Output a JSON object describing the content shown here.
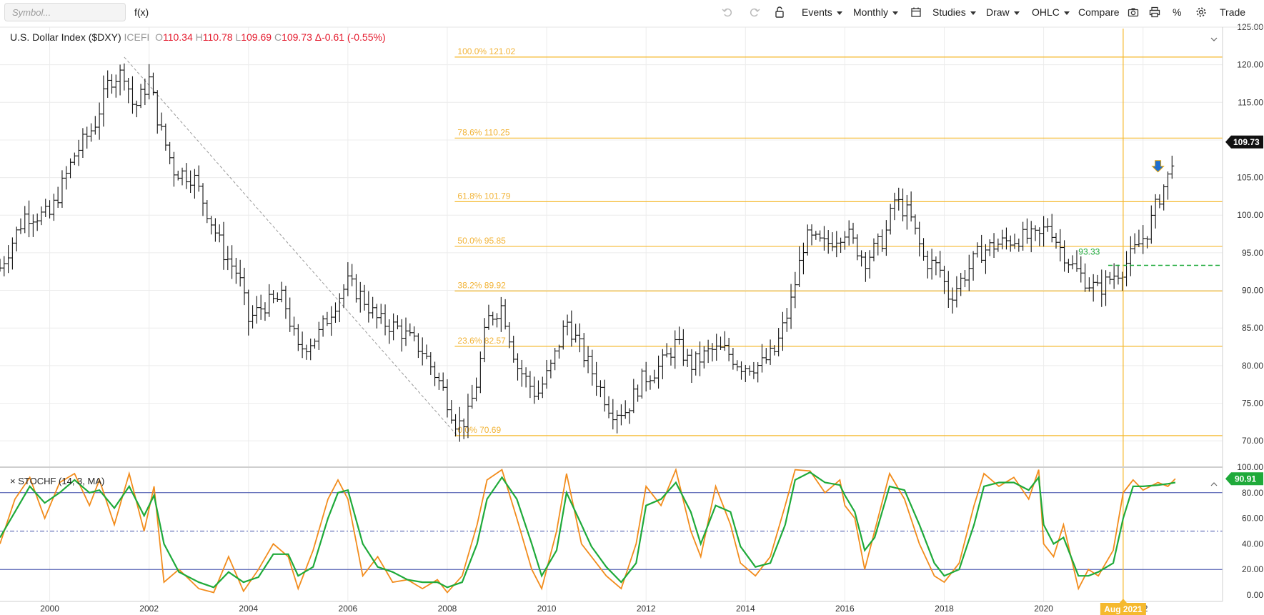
{
  "toolbar": {
    "symbol_placeholder": "Symbol...",
    "fx_label": "f(x)",
    "events_label": "Events",
    "period_label": "Monthly",
    "studies_label": "Studies",
    "draw_label": "Draw",
    "charttype_label": "OHLC",
    "compare_label": "Compare",
    "percent_label": "%",
    "trade_label": "Trade"
  },
  "header": {
    "name": "U.S. Dollar Index ($DXY)",
    "exchange": "ICEFI",
    "o_label": "O",
    "open": "110.34",
    "h_label": "H",
    "high": "110.78",
    "l_label": "L",
    "low": "109.69",
    "c_label": "C",
    "close": "109.73",
    "change": "Δ-0.61 (-0.55%)"
  },
  "stoch": {
    "label": "STOCHF (14, 3, MA)",
    "close_symbol": "×"
  },
  "colors": {
    "fib": "#f5b92e",
    "fib_text": "#f2b438",
    "price_bar": "#111111",
    "stoch_k": "#f28c1c",
    "stoch_d": "#1faa3a",
    "level_line": "#3b4aa8",
    "support": "#1faa3a",
    "vertical_marker": "#f5b92e",
    "arrow": "#1f6fd1"
  },
  "chart_data": [
    {
      "type": "ohlc",
      "title": "U.S. Dollar Index ($DXY)",
      "period": "monthly",
      "ylim": [
        66.5,
        125
      ],
      "y_ticks": [
        "125.00",
        "120.00",
        "115.00",
        "110.00",
        "105.00",
        "100.00",
        "95.00",
        "90.00",
        "85.00",
        "80.00",
        "75.00",
        "70.00"
      ],
      "x_ticks": [
        "2000",
        "2002",
        "2004",
        "2006",
        "2008",
        "2010",
        "2012",
        "2014",
        "2016",
        "2018",
        "2020",
        "22"
      ],
      "x_highlight": "Aug 2021",
      "last_price": "109.73",
      "support_label": "93.33",
      "support_level": 93.33,
      "fib_levels": [
        {
          "label": "100.0% 121.02",
          "value": 121.02
        },
        {
          "label": "78.6% 110.25",
          "value": 110.25
        },
        {
          "label": "61.8% 101.79",
          "value": 101.79
        },
        {
          "label": "50.0% 95.85",
          "value": 95.85
        },
        {
          "label": "38.2% 89.92",
          "value": 89.92
        },
        {
          "label": "23.6% 82.57",
          "value": 82.57
        },
        {
          "label": "0.0% 70.69",
          "value": 70.69
        }
      ],
      "trendline": [
        {
          "x": 2001.5,
          "y": 121.02
        },
        {
          "x": 2008.2,
          "y": 70.69
        }
      ],
      "price_path": [
        [
          1999.0,
          93
        ],
        [
          1999.5,
          100
        ],
        [
          2000.0,
          100
        ],
        [
          2000.5,
          108
        ],
        [
          2000.9,
          112
        ],
        [
          2001.2,
          118
        ],
        [
          2001.5,
          119
        ],
        [
          2001.7,
          114
        ],
        [
          2002.0,
          118
        ],
        [
          2002.2,
          112
        ],
        [
          2002.5,
          106
        ],
        [
          2002.9,
          105
        ],
        [
          2003.2,
          100
        ],
        [
          2003.5,
          95
        ],
        [
          2003.8,
          92
        ],
        [
          2004.0,
          86
        ],
        [
          2004.3,
          88
        ],
        [
          2004.7,
          89
        ],
        [
          2005.0,
          82
        ],
        [
          2005.4,
          84
        ],
        [
          2005.8,
          89
        ],
        [
          2006.0,
          91
        ],
        [
          2006.3,
          89
        ],
        [
          2006.6,
          86
        ],
        [
          2007.0,
          85
        ],
        [
          2007.5,
          82
        ],
        [
          2007.9,
          77
        ],
        [
          2008.2,
          72
        ],
        [
          2008.4,
          73
        ],
        [
          2008.6,
          78
        ],
        [
          2008.8,
          86
        ],
        [
          2009.1,
          88
        ],
        [
          2009.4,
          80
        ],
        [
          2009.8,
          76
        ],
        [
          2010.1,
          80
        ],
        [
          2010.4,
          86
        ],
        [
          2010.7,
          82
        ],
        [
          2011.0,
          78
        ],
        [
          2011.3,
          74
        ],
        [
          2011.6,
          74
        ],
        [
          2011.9,
          78
        ],
        [
          2012.3,
          80
        ],
        [
          2012.6,
          83
        ],
        [
          2012.9,
          80
        ],
        [
          2013.3,
          82
        ],
        [
          2013.6,
          82
        ],
        [
          2013.9,
          80
        ],
        [
          2014.3,
          80
        ],
        [
          2014.6,
          82
        ],
        [
          2014.9,
          88
        ],
        [
          2015.2,
          97
        ],
        [
          2015.6,
          96
        ],
        [
          2016.0,
          98
        ],
        [
          2016.4,
          94
        ],
        [
          2016.8,
          97
        ],
        [
          2017.0,
          102
        ],
        [
          2017.3,
          100
        ],
        [
          2017.6,
          94
        ],
        [
          2017.9,
          93
        ],
        [
          2018.1,
          89
        ],
        [
          2018.4,
          92
        ],
        [
          2018.7,
          95
        ],
        [
          2019.0,
          96
        ],
        [
          2019.5,
          97
        ],
        [
          2019.9,
          97
        ],
        [
          2020.1,
          99
        ],
        [
          2020.3,
          96
        ],
        [
          2020.6,
          93
        ],
        [
          2020.9,
          91
        ],
        [
          2021.1,
          90
        ],
        [
          2021.4,
          92
        ],
        [
          2021.6,
          93
        ],
        [
          2021.9,
          96
        ],
        [
          2022.1,
          98
        ],
        [
          2022.3,
          102
        ],
        [
          2022.5,
          105
        ],
        [
          2022.65,
          109.73
        ]
      ]
    },
    {
      "type": "line",
      "title": "STOCHF (14, 3, MA)",
      "ylim": [
        -5,
        100
      ],
      "y_ticks": [
        "100.00",
        "80.00",
        "60.00",
        "40.00",
        "20.00",
        "0.00"
      ],
      "levels": [
        80,
        50,
        20
      ],
      "last_value": "90.91",
      "series": [
        {
          "name": "%K",
          "points": [
            [
              1999.0,
              40
            ],
            [
              1999.3,
              75
            ],
            [
              1999.6,
              92
            ],
            [
              1999.9,
              60
            ],
            [
              2000.2,
              88
            ],
            [
              2000.5,
              95
            ],
            [
              2000.8,
              70
            ],
            [
              2001.0,
              90
            ],
            [
              2001.3,
              55
            ],
            [
              2001.6,
              95
            ],
            [
              2001.9,
              50
            ],
            [
              2002.1,
              85
            ],
            [
              2002.3,
              10
            ],
            [
              2002.6,
              20
            ],
            [
              2003.0,
              5
            ],
            [
              2003.3,
              2
            ],
            [
              2003.6,
              30
            ],
            [
              2003.9,
              3
            ],
            [
              2004.2,
              20
            ],
            [
              2004.5,
              40
            ],
            [
              2004.8,
              30
            ],
            [
              2005.0,
              5
            ],
            [
              2005.3,
              35
            ],
            [
              2005.6,
              75
            ],
            [
              2005.8,
              90
            ],
            [
              2006.0,
              75
            ],
            [
              2006.3,
              15
            ],
            [
              2006.6,
              30
            ],
            [
              2006.9,
              10
            ],
            [
              2007.2,
              12
            ],
            [
              2007.5,
              5
            ],
            [
              2007.8,
              12
            ],
            [
              2008.0,
              2
            ],
            [
              2008.3,
              15
            ],
            [
              2008.6,
              55
            ],
            [
              2008.8,
              90
            ],
            [
              2009.1,
              98
            ],
            [
              2009.4,
              60
            ],
            [
              2009.7,
              20
            ],
            [
              2009.9,
              5
            ],
            [
              2010.2,
              50
            ],
            [
              2010.4,
              95
            ],
            [
              2010.7,
              40
            ],
            [
              2010.9,
              30
            ],
            [
              2011.2,
              15
            ],
            [
              2011.5,
              5
            ],
            [
              2011.8,
              40
            ],
            [
              2012.0,
              85
            ],
            [
              2012.3,
              70
            ],
            [
              2012.6,
              98
            ],
            [
              2012.9,
              50
            ],
            [
              2013.1,
              30
            ],
            [
              2013.4,
              85
            ],
            [
              2013.7,
              55
            ],
            [
              2013.9,
              25
            ],
            [
              2014.2,
              15
            ],
            [
              2014.5,
              30
            ],
            [
              2014.8,
              70
            ],
            [
              2015.0,
              98
            ],
            [
              2015.3,
              97
            ],
            [
              2015.6,
              80
            ],
            [
              2015.9,
              90
            ],
            [
              2016.0,
              70
            ],
            [
              2016.2,
              60
            ],
            [
              2016.4,
              20
            ],
            [
              2016.6,
              50
            ],
            [
              2016.9,
              95
            ],
            [
              2017.2,
              75
            ],
            [
              2017.5,
              40
            ],
            [
              2017.8,
              15
            ],
            [
              2018.0,
              10
            ],
            [
              2018.3,
              25
            ],
            [
              2018.6,
              70
            ],
            [
              2018.8,
              95
            ],
            [
              2019.1,
              85
            ],
            [
              2019.4,
              92
            ],
            [
              2019.7,
              75
            ],
            [
              2019.9,
              98
            ],
            [
              2020.0,
              40
            ],
            [
              2020.2,
              30
            ],
            [
              2020.4,
              55
            ],
            [
              2020.7,
              5
            ],
            [
              2020.9,
              20
            ],
            [
              2021.1,
              15
            ],
            [
              2021.4,
              35
            ],
            [
              2021.6,
              80
            ],
            [
              2021.8,
              90
            ],
            [
              2022.0,
              82
            ],
            [
              2022.3,
              88
            ],
            [
              2022.5,
              85
            ],
            [
              2022.65,
              90.91
            ]
          ]
        },
        {
          "name": "%D",
          "points": [
            [
              1999.0,
              45
            ],
            [
              1999.3,
              65
            ],
            [
              1999.6,
              85
            ],
            [
              1999.9,
              72
            ],
            [
              2000.2,
              80
            ],
            [
              2000.5,
              90
            ],
            [
              2000.8,
              80
            ],
            [
              2001.0,
              82
            ],
            [
              2001.3,
              68
            ],
            [
              2001.6,
              85
            ],
            [
              2001.9,
              62
            ],
            [
              2002.1,
              78
            ],
            [
              2002.3,
              40
            ],
            [
              2002.6,
              18
            ],
            [
              2003.0,
              10
            ],
            [
              2003.3,
              6
            ],
            [
              2003.6,
              18
            ],
            [
              2003.9,
              10
            ],
            [
              2004.2,
              14
            ],
            [
              2004.5,
              32
            ],
            [
              2004.8,
              32
            ],
            [
              2005.0,
              15
            ],
            [
              2005.3,
              22
            ],
            [
              2005.6,
              60
            ],
            [
              2005.8,
              80
            ],
            [
              2006.0,
              82
            ],
            [
              2006.3,
              40
            ],
            [
              2006.6,
              22
            ],
            [
              2006.9,
              18
            ],
            [
              2007.2,
              12
            ],
            [
              2007.5,
              10
            ],
            [
              2007.8,
              10
            ],
            [
              2008.0,
              6
            ],
            [
              2008.3,
              10
            ],
            [
              2008.6,
              40
            ],
            [
              2008.8,
              75
            ],
            [
              2009.1,
              92
            ],
            [
              2009.4,
              75
            ],
            [
              2009.7,
              40
            ],
            [
              2009.9,
              15
            ],
            [
              2010.2,
              35
            ],
            [
              2010.4,
              80
            ],
            [
              2010.7,
              55
            ],
            [
              2010.9,
              38
            ],
            [
              2011.2,
              22
            ],
            [
              2011.5,
              10
            ],
            [
              2011.8,
              25
            ],
            [
              2012.0,
              70
            ],
            [
              2012.3,
              75
            ],
            [
              2012.6,
              88
            ],
            [
              2012.9,
              65
            ],
            [
              2013.1,
              40
            ],
            [
              2013.4,
              70
            ],
            [
              2013.7,
              65
            ],
            [
              2013.9,
              38
            ],
            [
              2014.2,
              22
            ],
            [
              2014.5,
              25
            ],
            [
              2014.8,
              55
            ],
            [
              2015.0,
              90
            ],
            [
              2015.3,
              96
            ],
            [
              2015.6,
              88
            ],
            [
              2015.9,
              86
            ],
            [
              2016.0,
              78
            ],
            [
              2016.2,
              65
            ],
            [
              2016.4,
              35
            ],
            [
              2016.6,
              45
            ],
            [
              2016.9,
              85
            ],
            [
              2017.2,
              82
            ],
            [
              2017.5,
              55
            ],
            [
              2017.8,
              25
            ],
            [
              2018.0,
              15
            ],
            [
              2018.3,
              20
            ],
            [
              2018.6,
              55
            ],
            [
              2018.8,
              85
            ],
            [
              2019.1,
              88
            ],
            [
              2019.4,
              88
            ],
            [
              2019.7,
              82
            ],
            [
              2019.9,
              92
            ],
            [
              2020.0,
              55
            ],
            [
              2020.2,
              40
            ],
            [
              2020.4,
              45
            ],
            [
              2020.7,
              15
            ],
            [
              2020.9,
              15
            ],
            [
              2021.1,
              18
            ],
            [
              2021.4,
              25
            ],
            [
              2021.6,
              60
            ],
            [
              2021.8,
              85
            ],
            [
              2022.0,
              85
            ],
            [
              2022.3,
              86
            ],
            [
              2022.5,
              87
            ],
            [
              2022.65,
              88
            ]
          ]
        }
      ]
    }
  ]
}
